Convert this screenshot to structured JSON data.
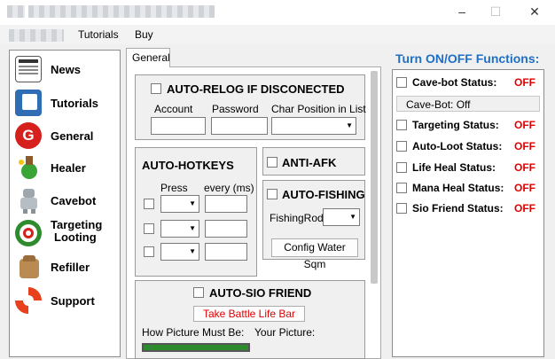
{
  "window": {
    "minimize_glyph": "–",
    "maximize_glyph": "☐",
    "close_glyph": "✕"
  },
  "menu": {
    "items": [
      "Tutorials",
      "Buy"
    ]
  },
  "nav": {
    "items": [
      {
        "label": "News",
        "icon": "newspaper-icon"
      },
      {
        "label": "Tutorials",
        "icon": "book-icon"
      },
      {
        "label": "General",
        "icon": "general-g-icon"
      },
      {
        "label": "Healer",
        "icon": "potion-icon"
      },
      {
        "label": "Cavebot",
        "icon": "robot-icon"
      },
      {
        "label": "Targeting",
        "label2": "Looting",
        "icon": "target-icon"
      },
      {
        "label": "Refiller",
        "icon": "backpack-icon"
      },
      {
        "label": "Support",
        "icon": "lifebuoy-icon"
      }
    ]
  },
  "tab": {
    "label": "General"
  },
  "relog": {
    "title": "AUTO-RELOG IF DISCONECTED",
    "account_label": "Account",
    "password_label": "Password",
    "charpos_label": "Char Position in List",
    "account_value": "",
    "password_value": ""
  },
  "hotkeys": {
    "title": "AUTO-HOTKEYS",
    "press_label": "Press",
    "every_label": "every (ms)"
  },
  "antiafk": {
    "title": "ANTI-AFK"
  },
  "fishing": {
    "title": "AUTO-FISHING",
    "rod_label": "FishingRod",
    "config_button": "Config Water Sqm"
  },
  "sio": {
    "title": "AUTO-SIO FRIEND",
    "battle_button": "Take Battle Life Bar",
    "how_label": "How Picture Must Be:",
    "your_label": "Your Picture:"
  },
  "right": {
    "heading": "Turn ON/OFF Functions:",
    "cavebot_status_label": "Cave-bot Status:",
    "cavebot_status_value": "OFF",
    "cavebot_field": "Cave-Bot: Off",
    "rows": [
      {
        "label": "Targeting Status:",
        "value": "OFF"
      },
      {
        "label": "Auto-Loot Status:",
        "value": "OFF"
      },
      {
        "label": "Life Heal Status:",
        "value": "OFF"
      },
      {
        "label": "Mana Heal Status:",
        "value": "OFF"
      },
      {
        "label": "Sio Friend Status:",
        "value": "OFF"
      }
    ]
  },
  "colors": {
    "heading_blue": "#1f6fc5",
    "status_red": "#e00000",
    "life_bar_green": "#2e8b2e"
  }
}
